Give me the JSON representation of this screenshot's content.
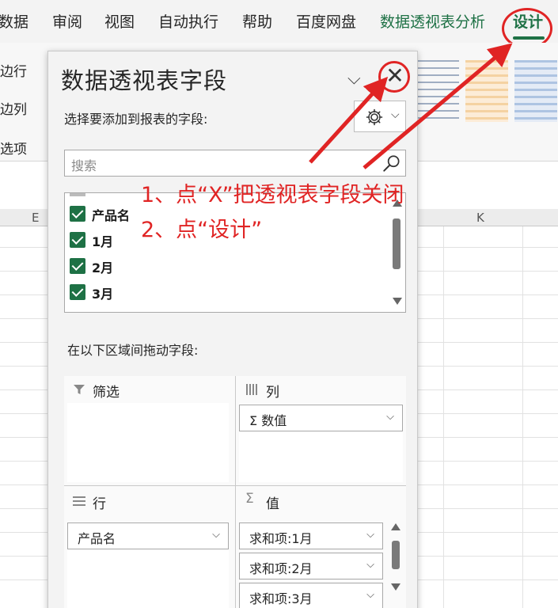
{
  "ribbon": {
    "tabs": [
      "数据",
      "审阅",
      "视图",
      "自动执行",
      "帮助",
      "百度网盘",
      "数据透视表分析",
      "设计"
    ],
    "active_tab": "设计",
    "left_labels": [
      "边行",
      "边列",
      "选项"
    ]
  },
  "sheet": {
    "col_e": "E",
    "col_k": "K"
  },
  "pane": {
    "title": "数据透视表字段",
    "chevron": "⌵",
    "close": "✕",
    "subtitle": "选择要添加到报表的字段:",
    "search_placeholder": "搜索",
    "fields": [
      "产品名",
      "1月",
      "2月",
      "3月"
    ],
    "drag_label": "在以下区域间拖动字段:",
    "areas": {
      "filter": {
        "label": "筛选"
      },
      "columns": {
        "label": "列",
        "items": [
          "Σ 数值"
        ]
      },
      "rows": {
        "label": "行",
        "items": [
          "产品名"
        ]
      },
      "values": {
        "label": "值",
        "items": [
          "求和项:1月",
          "求和项:2月",
          "求和项:3月"
        ]
      }
    }
  },
  "annotations": {
    "step1": "1、点“X”把透视表字段关闭",
    "step2": "2、点“设计”"
  },
  "colors": {
    "accent_green": "#1e7145",
    "annotation_red": "#e02424"
  }
}
